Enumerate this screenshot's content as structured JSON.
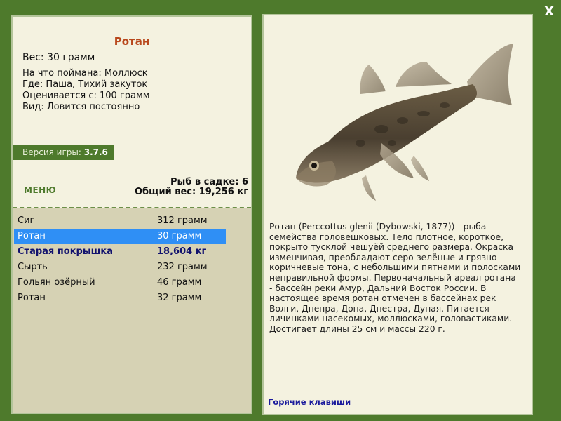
{
  "close_label": "X",
  "fish": {
    "title": "Ротан",
    "weight_line": "Вес: 30 грамм",
    "caught_on": "На что поймана: Моллюск",
    "where": "Где: Паша, Тихий закуток",
    "valued_from": "Оценивается с: 100 грамм",
    "kind": "Вид: Ловится постоянно"
  },
  "version": {
    "label": "Версия игры:",
    "value": "3.7.6"
  },
  "menu_label": "МЕНЮ",
  "stats": {
    "fish_in_cage": "Рыб в садке: 6",
    "total_weight": "Общий вес: 19,256 кг"
  },
  "catch": [
    {
      "name": "Сиг",
      "weight": "312 грамм"
    },
    {
      "name": "Ротан",
      "weight": "30 грамм"
    },
    {
      "name": "Старая покрышка",
      "weight": "18,604 кг"
    },
    {
      "name": "Сырть",
      "weight": "232 грамм"
    },
    {
      "name": "Гольян озёрный",
      "weight": "46 грамм"
    },
    {
      "name": "Ротан",
      "weight": "32 грамм"
    }
  ],
  "description": "Ротан (Perccottus glenii (Dybowski, 1877)) - рыба семейства головешковых. Тело плотное, короткое, покрыто тусклой чешуёй среднего размера. Окраска изменчивая, преобладают серо-зелёные и грязно-коричневые тона, с небольшими пятнами и полосками неправильной формы. Первоначальный ареал ротана - бассейн реки Амур, Дальний Восток России. В настоящее время ротан отмечен в бассейнах рек Волги, Днепра, Дона, Днестра, Дуная. Питается личинками насекомых, моллюсками, головастиками. Достигает длины 25 см и массы 220 г.",
  "hotkeys_label": "Горячие клавиши",
  "colors": {
    "background": "#4e7a2c",
    "panel": "#f4f2e0",
    "title": "#b8471b",
    "selected_row": "#2f8ff5",
    "highlight_row_text": "#12126e"
  }
}
